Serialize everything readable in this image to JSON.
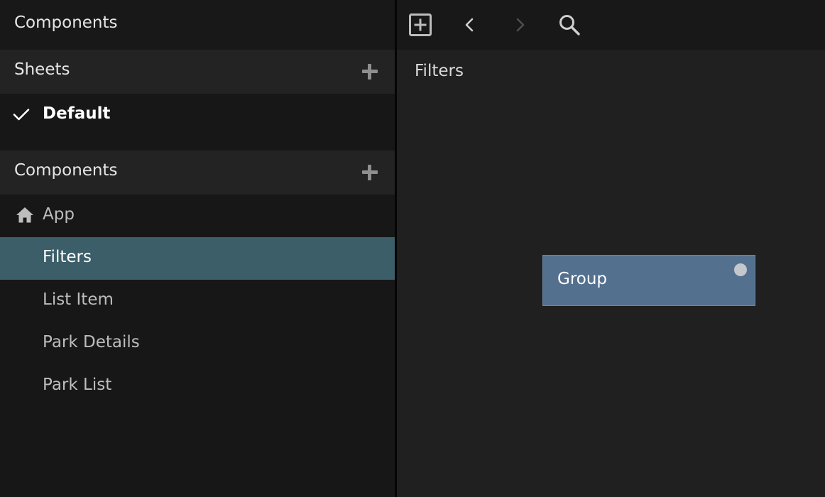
{
  "sidebar": {
    "title": "Components",
    "sheets_header": "Sheets",
    "sheets": [
      {
        "label": "Default",
        "checked": true
      }
    ],
    "components_header": "Components",
    "components": [
      {
        "label": "App",
        "icon": "home-icon"
      },
      {
        "label": "Filters",
        "selected": true
      },
      {
        "label": "List Item"
      },
      {
        "label": "Park Details"
      },
      {
        "label": "Park List"
      }
    ]
  },
  "toolbar": {
    "icons": [
      "add-box-icon",
      "chevron-left-icon",
      "chevron-right-icon",
      "search-icon"
    ]
  },
  "main": {
    "title": "Filters",
    "node": {
      "label": "Group"
    }
  },
  "colors": {
    "selected_row": "#3c5e69",
    "node_fill": "#54708f",
    "background": "#202020"
  }
}
